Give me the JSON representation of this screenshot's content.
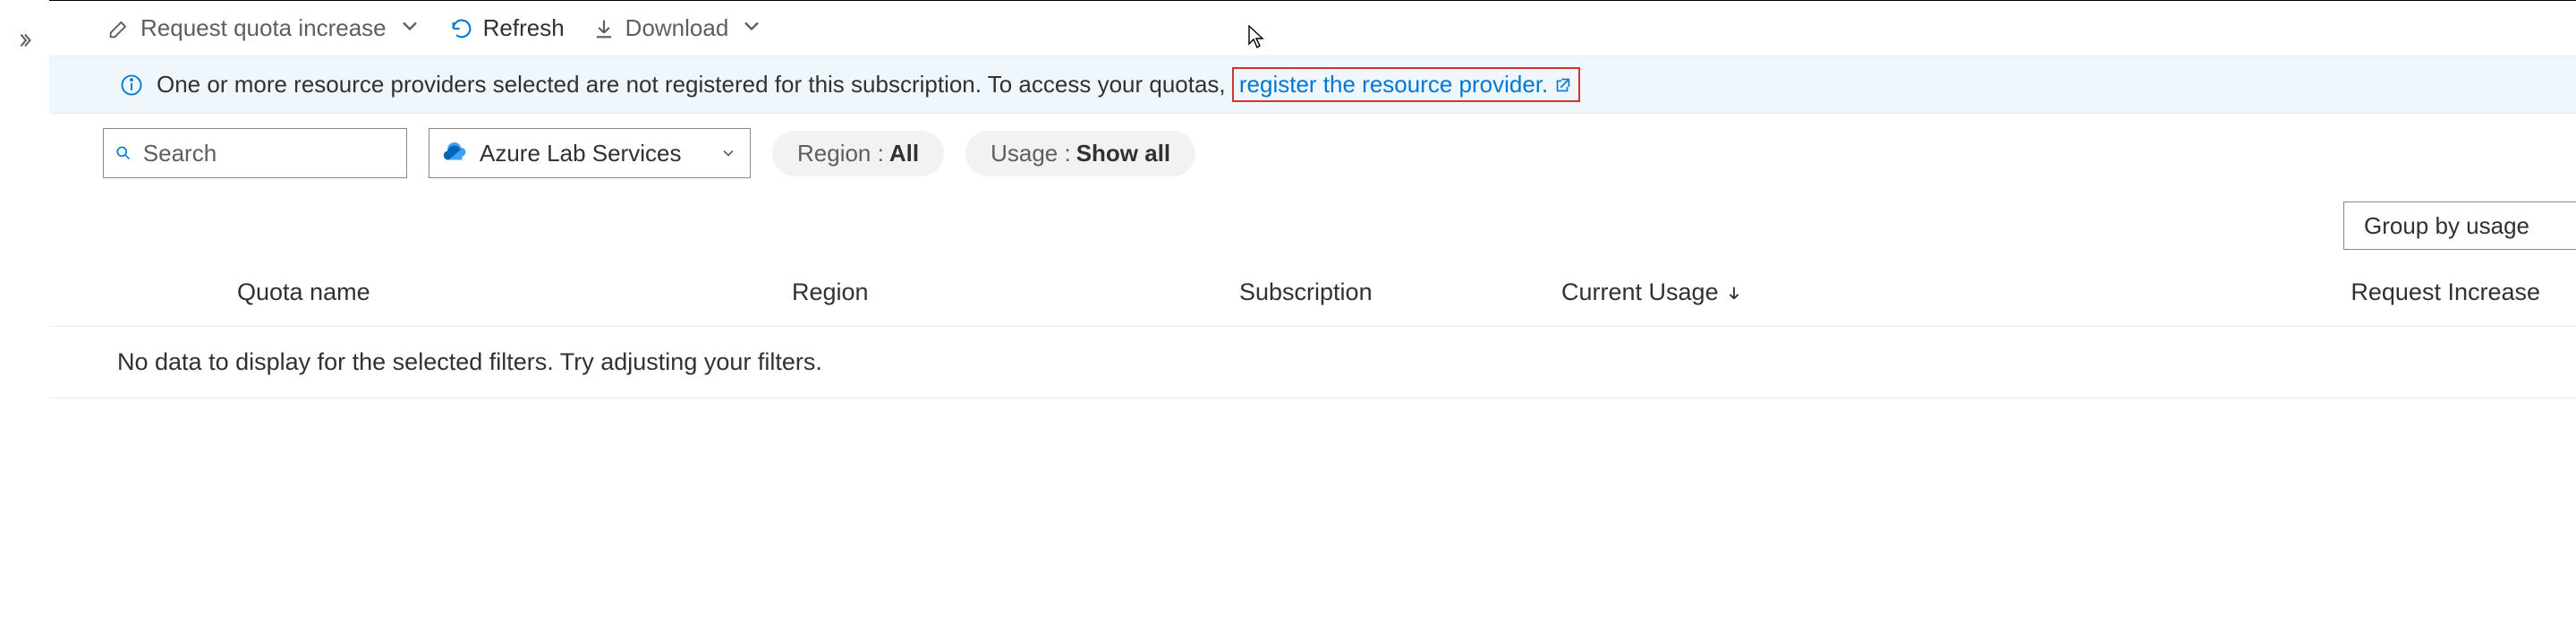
{
  "toolbar": {
    "request_increase": "Request quota increase",
    "refresh": "Refresh",
    "download": "Download"
  },
  "banner": {
    "text": "One or more resource providers selected are not registered for this subscription. To access your quotas, ",
    "link": "register the resource provider."
  },
  "filters": {
    "search_placeholder": "Search",
    "provider": "Azure Lab Services",
    "region_label": "Region :",
    "region_value": "All",
    "usage_label": "Usage :",
    "usage_value": "Show all"
  },
  "group_by": "Group by usage",
  "table": {
    "headers": {
      "quota_name": "Quota name",
      "region": "Region",
      "subscription": "Subscription",
      "current_usage": "Current Usage",
      "request_increase": "Request Increase"
    },
    "empty": "No data to display for the selected filters. Try adjusting your filters."
  }
}
